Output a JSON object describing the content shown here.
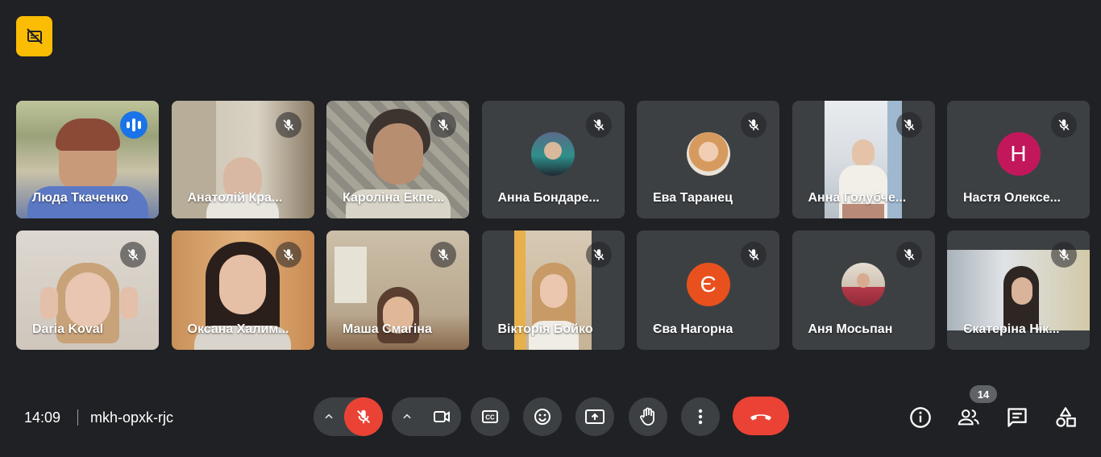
{
  "meeting": {
    "time": "14:09",
    "code": "mkh-opxk-rjc",
    "participant_count": "14"
  },
  "colors": {
    "background": "#202124",
    "tile": "#3c4043",
    "accent_yellow": "#fbbc04",
    "speaking_blue": "#8ab4f8",
    "end_call_red": "#ea4335"
  },
  "top_badge": {
    "icon": "captions-off-icon"
  },
  "tiles": [
    {
      "name": "Люда Ткаченко",
      "state": "speaking"
    },
    {
      "name": "Анатолій Кра...",
      "state": "muted"
    },
    {
      "name": "Кароліна Екпе...",
      "state": "muted"
    },
    {
      "name": "Анна Бондаре...",
      "state": "muted"
    },
    {
      "name": "Ева Таранец",
      "state": "muted"
    },
    {
      "name": "Анна Голубче...",
      "state": "muted"
    },
    {
      "name": "Настя Олексе...",
      "state": "muted",
      "avatar_letter": "Н",
      "avatar_color": "#c2185b"
    },
    {
      "name": "Daria Koval",
      "state": "muted"
    },
    {
      "name": "Оксана Халим...",
      "state": "muted"
    },
    {
      "name": "Маша Смагіна",
      "state": "muted"
    },
    {
      "name": "Вікторія Бойко",
      "state": "muted"
    },
    {
      "name": "Єва Нагорна",
      "state": "muted",
      "avatar_letter": "Є",
      "avatar_color": "#e8501e"
    },
    {
      "name": "Аня Мосьпан",
      "state": "muted"
    },
    {
      "name": "Єкатеріна Нік...",
      "state": "muted"
    }
  ],
  "controls": [
    "microphone-off-icon",
    "camera-icon",
    "closed-captions-icon",
    "emoji-icon",
    "present-screen-icon",
    "raise-hand-icon",
    "more-options-icon",
    "end-call-icon"
  ],
  "side_controls": [
    "info-icon",
    "people-icon",
    "chat-icon",
    "activities-icon"
  ]
}
